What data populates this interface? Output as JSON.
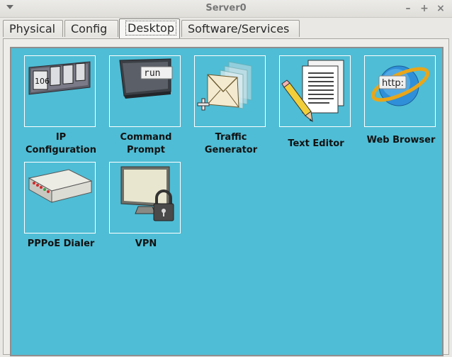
{
  "window": {
    "title": "Server0",
    "controls": {
      "minimize": "–",
      "maximize": "+",
      "close": "×"
    }
  },
  "tabs": [
    {
      "label": "Physical"
    },
    {
      "label": "Config"
    },
    {
      "label": "Desktop",
      "active": true
    },
    {
      "label": "Software/Services"
    }
  ],
  "apps": [
    {
      "id": "ip-configuration",
      "label_lines": [
        "IP",
        "Configuration"
      ],
      "icon": "ip-configuration-icon",
      "icon_text": "106"
    },
    {
      "id": "command-prompt",
      "label_lines": [
        "Command",
        "Prompt"
      ],
      "icon": "command-prompt-icon",
      "icon_text": "run"
    },
    {
      "id": "traffic-generator",
      "label_lines": [
        "Traffic",
        "Generator"
      ],
      "icon": "traffic-generator-icon"
    },
    {
      "id": "text-editor",
      "label_lines": [
        "Text Editor"
      ],
      "icon": "text-editor-icon"
    },
    {
      "id": "web-browser",
      "label_lines": [
        "Web Browser"
      ],
      "icon": "web-browser-icon",
      "icon_text": "http:"
    },
    {
      "id": "pppoe-dialer",
      "label_lines": [
        "PPPoE Dialer"
      ],
      "icon": "pppoe-dialer-icon"
    },
    {
      "id": "vpn",
      "label_lines": [
        "VPN"
      ],
      "icon": "vpn-icon"
    }
  ],
  "colors": {
    "desktop_bg": "#4fbdd5",
    "tile_border": "#ffffff"
  }
}
